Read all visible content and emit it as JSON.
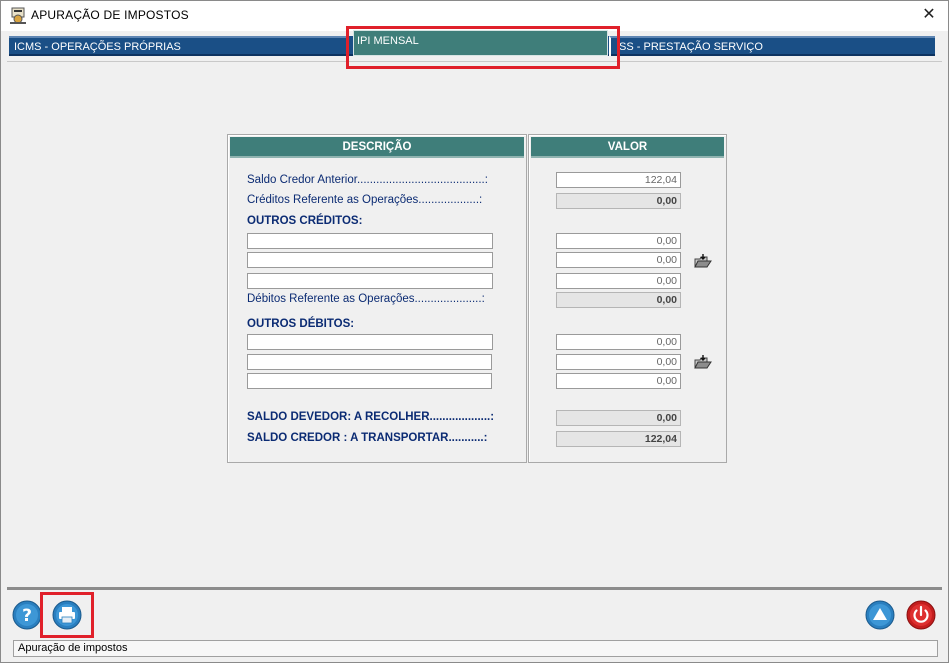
{
  "window": {
    "title": "APURAÇÃO  DE  IMPOSTOS",
    "close_glyph": "✕"
  },
  "tabs": [
    {
      "label": "ICMS - OPERAÇÕES PRÓPRIAS",
      "selected": false
    },
    {
      "label": "IPI  MENSAL",
      "selected": true
    },
    {
      "label": "ISS - PRESTAÇÃO SERVIÇO",
      "selected": false
    }
  ],
  "table": {
    "header_desc": "DESCRIÇÃO",
    "header_value": "VALOR",
    "saldo_credor_anterior": {
      "label": "Saldo Credor Anterior........................................:",
      "value": "122,04"
    },
    "creditos_operacoes": {
      "label": "Créditos Referente as Operações...................:",
      "value": "0,00"
    },
    "outros_creditos": {
      "label": "OUTROS CRÉDITOS:",
      "values": [
        "0,00",
        "0,00",
        "0,00"
      ]
    },
    "debitos_operacoes": {
      "label": "Débitos Referente as Operações.....................:",
      "value": "0,00"
    },
    "outros_debitos": {
      "label": "OUTROS DÉBITOS:",
      "values": [
        "0,00",
        "0,00",
        "0,00"
      ]
    },
    "saldo_devedor": {
      "label": "SALDO DEVEDOR:  A  RECOLHER...................:",
      "value": "0,00"
    },
    "saldo_credor": {
      "label": "SALDO CREDOR  :  A  TRANSPORTAR...........:",
      "value": "122,04"
    }
  },
  "icons": {
    "title": "tax-app-icon",
    "import": "folder-import-icon",
    "help": "help-icon",
    "print": "printer-icon",
    "up": "arrow-up-icon",
    "power": "power-icon"
  },
  "colors": {
    "tab_bar": "#1a4f86",
    "selected_tab": "#3f7e7a",
    "highlight": "#e0202a"
  },
  "status": {
    "text": "Apuração de impostos"
  }
}
